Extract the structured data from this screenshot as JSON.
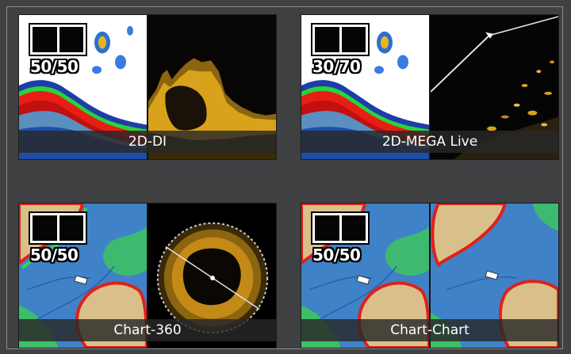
{
  "tiles": [
    {
      "id": "2d-di",
      "label": "2D-DI",
      "ratio": "50/50"
    },
    {
      "id": "2d-mega-live",
      "label": "2D-MEGA Live",
      "ratio": "30/70"
    },
    {
      "id": "chart-360",
      "label": "Chart-360",
      "ratio": "50/50"
    },
    {
      "id": "chart-chart",
      "label": "Chart-Chart",
      "ratio": "50/50"
    }
  ],
  "colors": {
    "background": "#3f4143",
    "water": "#3f82c8",
    "land": "#d9c08a",
    "contour_red": "#e0201a",
    "contour_green": "#3ed24a",
    "sonar_gold": "#d9a21b"
  }
}
